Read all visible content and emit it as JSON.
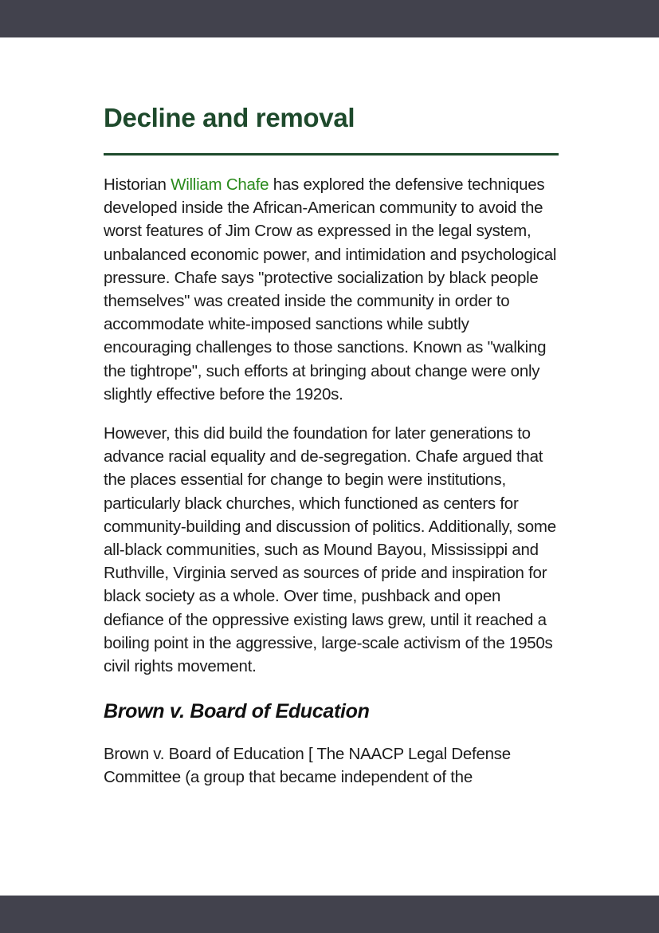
{
  "section": {
    "title": "Decline and removal"
  },
  "paragraph1": {
    "before_link": "Historian ",
    "link_text": "William Chafe",
    "after_link": " has explored the defensive techniques developed inside the African-American community to avoid the worst features of Jim Crow as expressed in the legal system, unbalanced economic power, and intimidation and psychological pressure. Chafe says \"protective socialization by black people themselves\" was created inside the community in order to accommodate white-imposed sanctions while subtly encouraging challenges to those sanctions. Known as \"walking the tightrope\", such efforts at bringing about change were only slightly effective before the 1920s."
  },
  "paragraph2": {
    "text": "However, this did build the foundation for later generations to advance racial equality and de-segregation. Chafe argued that the places essential for change to begin were institutions, particularly black churches, which functioned as centers for community-building and discussion of politics. Additionally, some all-black communities, such as Mound Bayou, Mississippi and Ruthville, Virginia served as sources of pride and inspiration for black society as a whole. Over time, pushback and open defiance of the oppressive existing laws grew, until it reached a boiling point in the aggressive, large-scale activism of the 1950s civil rights movement."
  },
  "subsection": {
    "title": "Brown v. Board of Education"
  },
  "paragraph3": {
    "text": "Brown v. Board of Education [ The NAACP Legal Defense Committee (a group that became independent of the"
  },
  "colors": {
    "heading": "#1e4a2c",
    "link": "#2a8a1c",
    "bars": "#42424d"
  }
}
